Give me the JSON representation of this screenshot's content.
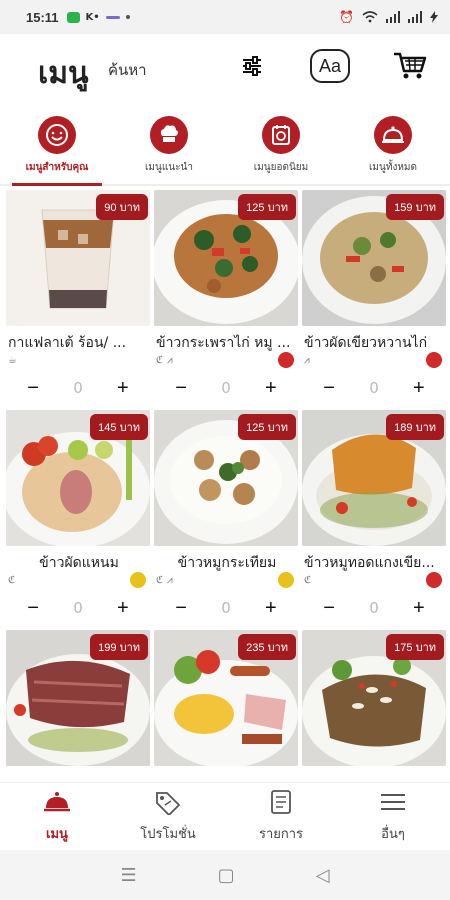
{
  "status": {
    "time": "15:11"
  },
  "header": {
    "title": "เมนู",
    "search_label": "ค้นหา"
  },
  "categories": [
    {
      "label": "เมนูสำหรับคุณ",
      "icon": "smile-icon"
    },
    {
      "label": "เมนูแนะนำ",
      "icon": "chef-hat-icon"
    },
    {
      "label": "เมนูยอดนิยม",
      "icon": "plate-icon"
    },
    {
      "label": "เมนูทั้งหมด",
      "icon": "cloche-icon"
    }
  ],
  "items": [
    {
      "name": "กาแฟลาเต้ ร้อน/ ...",
      "price": "90 บาท",
      "qty": "0",
      "photo": "iced-latte"
    },
    {
      "name": "ข้าวกระเพราไก่ หมู ...",
      "price": "125 บาท",
      "qty": "0",
      "photo": "basil-stirfry",
      "spice_color": "#d22a2a"
    },
    {
      "name": "ข้าวผัดเขียวหวานไก่",
      "price": "159 บาท",
      "qty": "0",
      "photo": "green-curry-rice",
      "spice_color": "#d22a2a"
    },
    {
      "name": "ข้าวผัดแหนม",
      "price": "145 บาท",
      "qty": "0",
      "photo": "fried-rice-nam",
      "spice_color": "#e8c21a"
    },
    {
      "name": "ข้าวหมูกระเทียม",
      "price": "125 บาท",
      "qty": "0",
      "photo": "garlic-pork",
      "spice_color": "#e8c21a"
    },
    {
      "name": "ข้าวหมูทอดแกงเขีย...",
      "price": "189 บาท",
      "qty": "0",
      "photo": "katsu-curry",
      "spice_color": "#d22a2a"
    },
    {
      "name": "",
      "price": "199 บาท",
      "qty": "",
      "photo": "beef-steak"
    },
    {
      "name": "",
      "price": "235 บาท",
      "qty": "",
      "photo": "breakfast-plate"
    },
    {
      "name": "",
      "price": "175 บาท",
      "qty": "",
      "photo": "chicken-salad"
    }
  ],
  "bottom_nav": [
    {
      "label": "เมนู",
      "icon": "cloche-icon"
    },
    {
      "label": "โปรโมชั่น",
      "icon": "tag-icon"
    },
    {
      "label": "รายการ",
      "icon": "list-icon"
    },
    {
      "label": "อื่นๆ",
      "icon": "menu-icon"
    }
  ],
  "colors": {
    "accent": "#b11e23",
    "price_badge": "#a31a1f"
  }
}
